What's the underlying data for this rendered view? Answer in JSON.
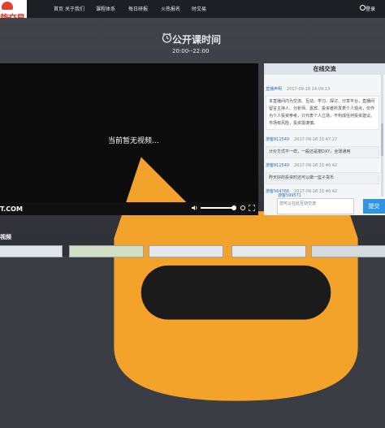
{
  "brand": {
    "logo_text": "势交易"
  },
  "nav": {
    "items": [
      "首页",
      "关于我们",
      "课程体系",
      "每日研报",
      "火热报名",
      "时交易"
    ],
    "login": "登录"
  },
  "course": {
    "title": "公开课时间",
    "time": "20:00--22:00"
  },
  "player": {
    "message": "当前暂无视频...",
    "watermark": "T.COM"
  },
  "chat": {
    "title": "在线交流",
    "messages": [
      {
        "user": "直播声明",
        "time": "2017-09-18 14:09:13",
        "text": "本直播间内为交流、互动、学习、探讨、分享平台，直播间留言主持人、分析师、嘉宾、投资者所发表个人观点，仅作为个人投资参考，只代表个人立场，不构成任何投资建议。市场有风险，投资需谨慎。"
      },
      {
        "user": "游客811549",
        "time": "2017-09-18 21:47:27",
        "text": "计价方式不一样，一般还是按DXY，全球通用"
      },
      {
        "user": "游客811549",
        "time": "2017-09-18 21:46:42",
        "text": "昨天好的投资时还可以做一篮子货币"
      },
      {
        "user": "游客564766",
        "time": "2017-09-18 21:46:42",
        "text": ""
      }
    ],
    "current_user": "游客599571",
    "input_placeholder": "您可以在此互动交流",
    "send_label": "提交"
  },
  "section": {
    "title": "视频"
  }
}
